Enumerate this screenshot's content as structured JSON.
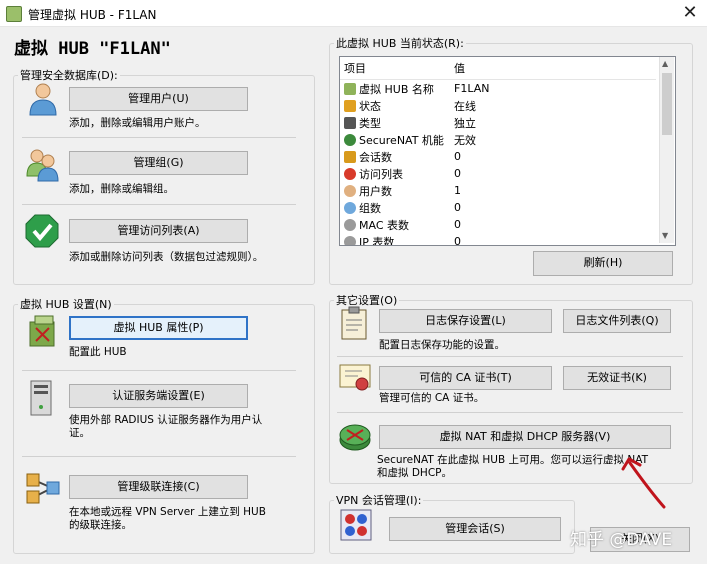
{
  "window": {
    "title": "管理虚拟 HUB - F1LAN",
    "close": "✕"
  },
  "heading": "虚拟 HUB \"F1LAN\"",
  "security_db": {
    "legend": "管理安全数据库(D):",
    "users_btn": "管理用户(U)",
    "users_desc": "添加，删除或编辑用户账户。",
    "groups_btn": "管理组(G)",
    "groups_desc": "添加，删除或编辑组。",
    "acl_btn": "管理访问列表(A)",
    "acl_desc": "添加或删除访问列表（数据包过滤规则）。"
  },
  "hub_settings": {
    "legend": "虚拟 HUB 设置(N)",
    "props_btn": "虚拟 HUB 属性(P)",
    "props_desc": "配置此 HUB",
    "radius_btn": "认证服务端设置(E)",
    "radius_desc_1": "使用外部 RADIUS 认证服务器作为用户认",
    "radius_desc_2": "证。",
    "cascade_btn": "管理级联连接(C)",
    "cascade_desc_1": "在本地或远程 VPN Server 上建立到 HUB",
    "cascade_desc_2": "的级联连接。"
  },
  "status": {
    "legend": "此虚拟 HUB 当前状态(R):",
    "col_item": "项目",
    "col_value": "值",
    "rows": [
      {
        "item": "虚拟 HUB 名称",
        "value": "F1LAN",
        "icon_color": "#8fb35a"
      },
      {
        "item": "状态",
        "value": "在线",
        "icon_color": "#e0a020"
      },
      {
        "item": "类型",
        "value": "独立",
        "icon_color": "#555555"
      },
      {
        "item": "SecureNAT 机能",
        "value": "无效",
        "icon_color": "#3c8a3c"
      },
      {
        "item": "会话数",
        "value": "0",
        "icon_color": "#d89a1c"
      },
      {
        "item": "访问列表",
        "value": "0",
        "icon_color": "#d83a2a"
      },
      {
        "item": "用户数",
        "value": "1",
        "icon_color": "#e0b080"
      },
      {
        "item": "组数",
        "value": "0",
        "icon_color": "#6fa8dc"
      },
      {
        "item": "MAC 表数",
        "value": "0",
        "icon_color": "#9a9a9a"
      },
      {
        "item": "IP 表数",
        "value": "0",
        "icon_color": "#9a9a9a"
      }
    ],
    "refresh_btn": "刷新(H)"
  },
  "other": {
    "legend": "其它设置(O)",
    "log_btn": "日志保存设置(L)",
    "logfiles_btn": "日志文件列表(Q)",
    "log_desc": "配置日志保存功能的设置。",
    "ca_btn": "可信的 CA 证书(T)",
    "crl_btn": "无效证书(K)",
    "ca_desc": "管理可信的 CA 证书。",
    "nat_btn": "虚拟 NAT 和虚拟 DHCP 服务器(V)",
    "nat_desc_1": "SecureNAT 在此虚拟 HUB 上可用。您可以运行虚拟 NAT",
    "nat_desc_2": "和虚拟 DHCP。"
  },
  "vpn_session": {
    "legend": "VPN 会话管理(I):",
    "session_btn": "管理会话(S)"
  },
  "close_btn": "关闭(X)",
  "watermark": "知乎 @DAVE",
  "colors": {
    "focus_border": "#2f73c7",
    "annotation": "#c0141c"
  }
}
